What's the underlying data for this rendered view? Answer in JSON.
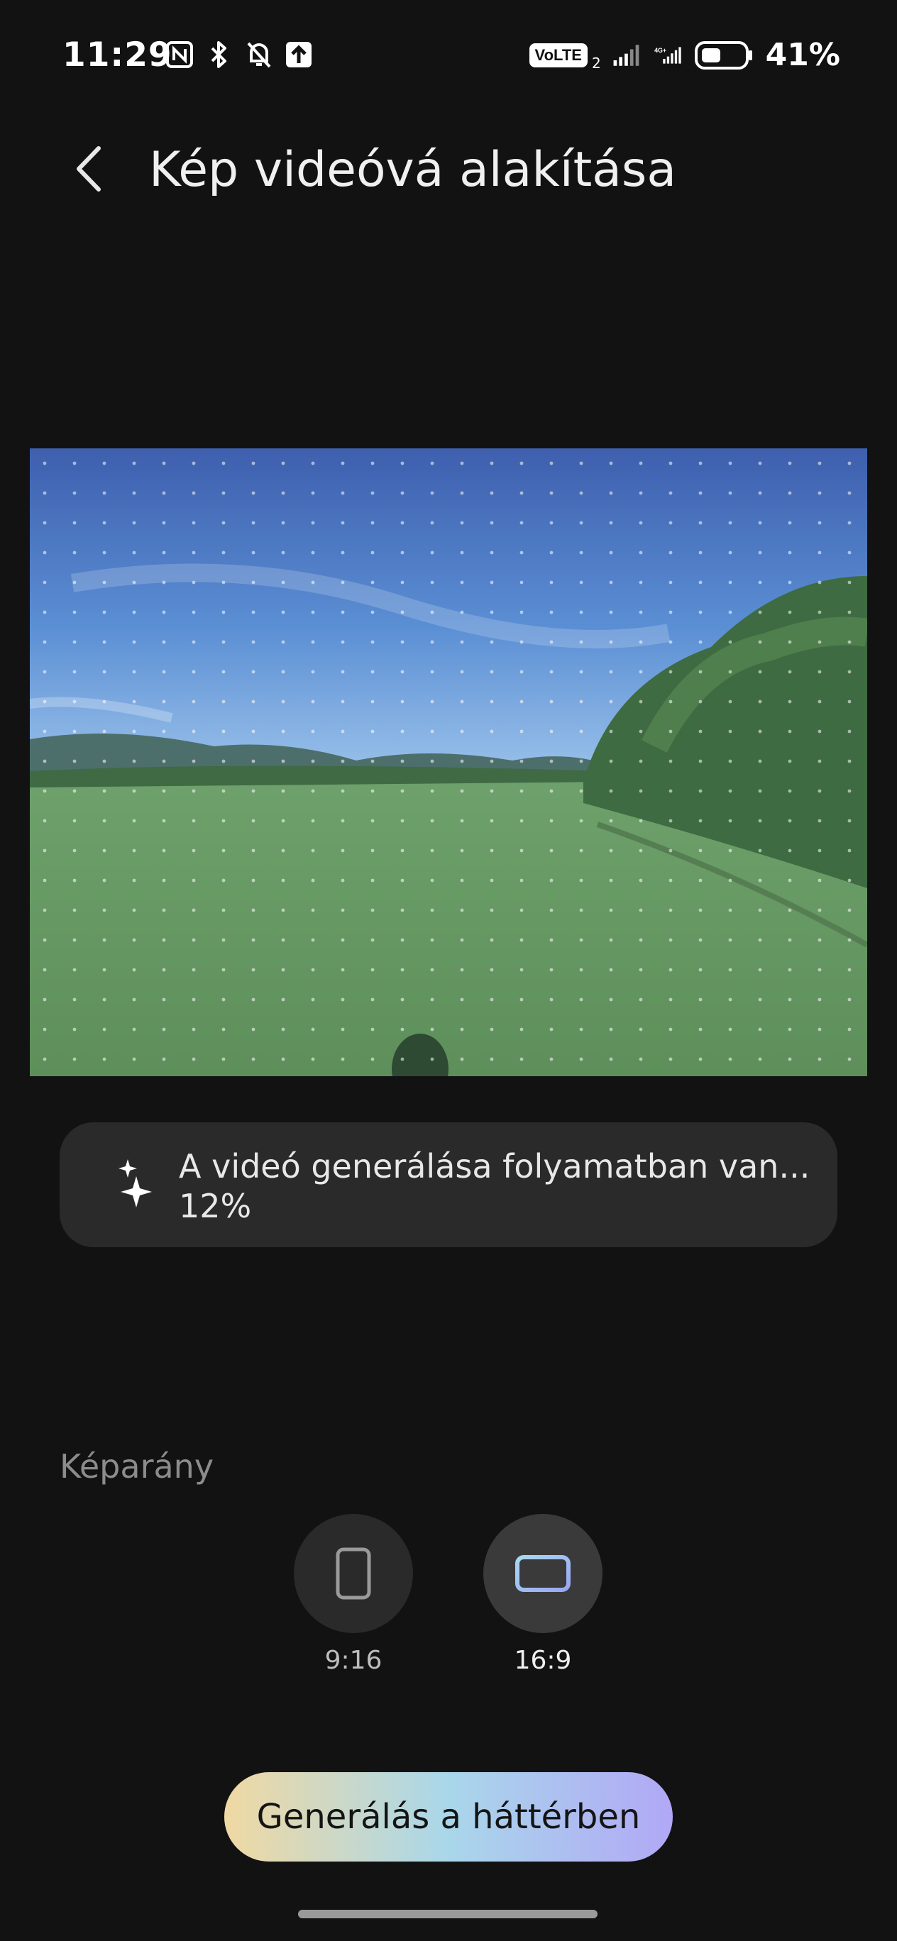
{
  "status_bar": {
    "time": "11:29",
    "volte": "VoLTE",
    "sim_index": "2",
    "battery": "41%",
    "icons": [
      "nfc-icon",
      "bluetooth-icon",
      "mute-bell-icon",
      "upload-icon",
      "signal-icon",
      "4g-signal-icon",
      "battery-icon"
    ]
  },
  "header": {
    "title": "Kép videóvá alakítása"
  },
  "progress": {
    "text": "A videó generálása folyamatban van...",
    "percent_text": "12%",
    "percent": 12
  },
  "aspect": {
    "label": "Képarány",
    "options": [
      {
        "label": "9:16",
        "selected": false
      },
      {
        "label": "16:9",
        "selected": true
      }
    ]
  },
  "actions": {
    "generate_label": "Generálás a háttérben"
  },
  "colors": {
    "background": "#121212",
    "pill": "#2a2a2a",
    "button_gradient": [
      "#f0d9a3",
      "#a9d7ea",
      "#b1a8f6"
    ]
  }
}
